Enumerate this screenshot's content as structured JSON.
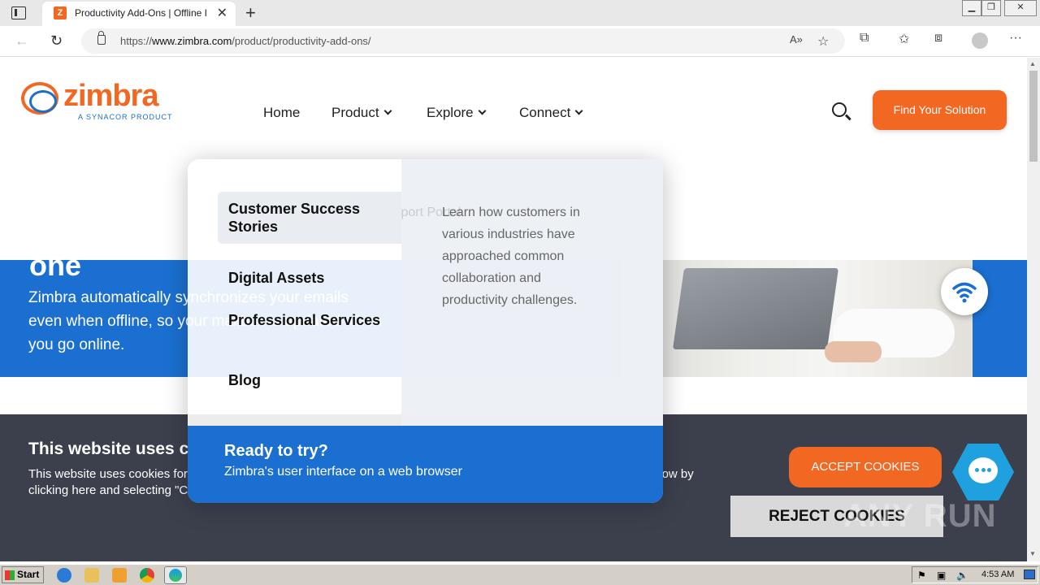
{
  "browser": {
    "tab_title": "Productivity Add-Ons | Offline I",
    "tab_favicon_letter": "Z",
    "url_prefix": "https://",
    "url_domain": "www.zimbra.com",
    "url_path": "/product/productivity-add-ons/"
  },
  "header": {
    "logo_word": "zimbra",
    "logo_tagline": "A SYNACOR PRODUCT",
    "nav": [
      {
        "label": "Home"
      },
      {
        "label": "Product"
      },
      {
        "label": "Explore"
      },
      {
        "label": "Connect"
      }
    ],
    "cta_label": "Find Your Solution"
  },
  "hero": {
    "heading_partial": "one",
    "text": "Zimbra automatically synchronizes your emails even when offline, so your mailbox is updated when you go online."
  },
  "dropdown": {
    "ghost_label": "Support Portal",
    "items": [
      {
        "label": "Customer Success Stories"
      },
      {
        "label": "Digital Assets"
      },
      {
        "label": "Professional Services"
      },
      {
        "label": "Blog"
      }
    ],
    "description": "Learn how customers in various industries have approached common collaboration and productivity challenges.",
    "footer_title": "Ready to try?",
    "footer_sub": "Zimbra's user interface on a web browser"
  },
  "cookie": {
    "title": "This website uses cookies",
    "body": "This website uses cookies for analytics, personalization and advertising purposes. You may customize cookies you allow by clicking here and selecting \"Cookie Preferences\". See our Privacy Policy for more information.",
    "accept_label": "ACCEPT COOKIES",
    "reject_label": "REJECT COOKIES",
    "watermark": "ANY RUN"
  },
  "taskbar": {
    "start_label": "Start",
    "clock": "4:53 AM"
  },
  "colors": {
    "brand_orange": "#f26722",
    "brand_blue": "#1b6fd0",
    "cookie_bg": "#3c404d",
    "chat_blue": "#1fa1e0"
  }
}
